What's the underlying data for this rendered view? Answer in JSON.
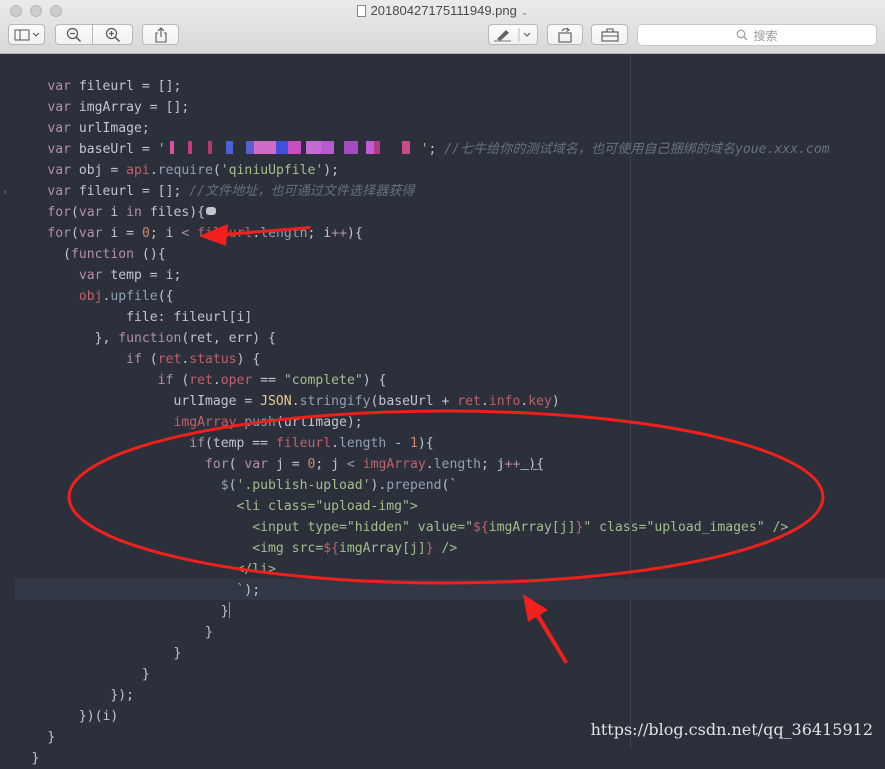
{
  "window": {
    "title": "20180427175111949.png"
  },
  "toolbar": {
    "sidebar_icon": "sidebar-icon",
    "zoom_out_icon": "zoom-out-icon",
    "zoom_in_icon": "zoom-in-icon",
    "share_icon": "share-icon",
    "markup_icon": "pen-icon",
    "rotate_icon": "rotate-icon",
    "toolbox_icon": "toolbox-icon",
    "search_placeholder": "搜索"
  },
  "code": {
    "l1_kw": "var",
    "l1_rest": " fileurl = [];",
    "l2_kw": "var",
    "l2_rest": " imgArray = [];",
    "l3_kw": "var",
    "l3_rest": " urlImage;",
    "l4_kw": "var",
    "l4_a": " baseUrl = ",
    "l4_q1": "'",
    "l4_q2": "'",
    "l4_b": "; ",
    "l4_comment": "//七牛给你的测试域名，也可使用自己捆绑的域名youe.xxx.com",
    "l5_kw": "var",
    "l5_a": " obj = ",
    "l5_api": "api",
    "l5_dot": ".",
    "l5_fn": "require",
    "l5_p1": "(",
    "l5_str": "'qiniuUpfile'",
    "l5_p2": ");",
    "l6_kw": "var",
    "l6_a": " fileurl = []; ",
    "l6_comment": "//文件地址，也可通过文件选择器获得",
    "l7_kw": "for",
    "l7_a": "(",
    "l7_kw2": "var",
    "l7_b": " i ",
    "l7_kw3": "in",
    "l7_c": " files){",
    "l8_kw": "for",
    "l8_a": "(",
    "l8_kw2": "var",
    "l8_b": " i = ",
    "l8_n": "0",
    "l8_c": "; i ",
    "l8_lt": "<",
    "l8_d": " ",
    "l8_pr": "fileurl",
    "l8_dot": ".",
    "l8_len": "length",
    "l8_e": "; i",
    "l8_pp": "++",
    "l8_f": "){",
    "l9_a": "(",
    "l9_kw": "function",
    "l9_b": " (){",
    "l10_kw": "var",
    "l10_a": " temp = i;",
    "l11_obj": "obj",
    "l11_dot": ".",
    "l11_fn": "upfile",
    "l11_a": "({",
    "l12_a": "file: fileurl[i]",
    "l13_a": "}, ",
    "l13_kw": "function",
    "l13_b": "(ret, err) {",
    "l14_kw": "if",
    "l14_a": " (",
    "l14_pr": "ret",
    "l14_dot": ".",
    "l14_st": "status",
    "l14_b": ") {",
    "l15_kw": "if",
    "l15_a": " (",
    "l15_pr": "ret",
    "l15_dot": ".",
    "l15_op": "oper",
    "l15_b": " == ",
    "l15_str": "\"complete\"",
    "l15_c": ") {",
    "l16_a": "urlImage = ",
    "l16_json": "JSON",
    "l16_dot": ".",
    "l16_fn": "stringify",
    "l16_b": "(baseUrl + ",
    "l16_pr": "ret",
    "l16_dot2": ".",
    "l16_info": "info",
    "l16_dot3": ".",
    "l16_key": "key",
    "l16_c": ")",
    "l17_pr": "imgArray",
    "l17_dot": ".",
    "l17_fn": "push",
    "l17_a": "(urlImage);",
    "l18_kw": "if",
    "l18_a": "(temp == ",
    "l18_pr": "fileurl",
    "l18_dot": ".",
    "l18_len": "length",
    "l18_b": " - ",
    "l18_n": "1",
    "l18_c": "){",
    "l19_kw": "for",
    "l19_a": "( ",
    "l19_kw2": "var",
    "l19_b": " j = ",
    "l19_n": "0",
    "l19_c": "; j ",
    "l19_lt": "<",
    "l19_d": " ",
    "l19_pr": "imgArray",
    "l19_dot": ".",
    "l19_len": "length",
    "l19_e": "; j",
    "l19_pp": "++",
    "l19_f": " ){",
    "l20_fn": "$",
    "l20_a": "(",
    "l20_str": "'.publish-upload'",
    "l20_b": ").",
    "l20_fn2": "prepend",
    "l20_c": "(`",
    "l21_str": "<li class=\"upload-img\">",
    "l22_str1": "<input type=\"hidden\" value=\"",
    "l22_tpl": "${",
    "l22_v": "imgArray[j]",
    "l22_tpl2": "}",
    "l22_str2": "\" class=\"upload_images\" />",
    "l23_str1": "<img src=",
    "l23_tpl": "${",
    "l23_v": "imgArray[j]",
    "l23_tpl2": "}",
    "l23_str2": " />",
    "l24_str": "</li>",
    "l25_str": "`",
    "l25_a": ");",
    "l26_a": "}",
    "l27_a": "}",
    "l28_a": "}",
    "l29_a": "}",
    "l30_a": "});",
    "l31_a": "})(i)",
    "l32_a": "}",
    "l33_a": "}"
  },
  "watermark": "https://blog.csdn.net/qq_36415912"
}
